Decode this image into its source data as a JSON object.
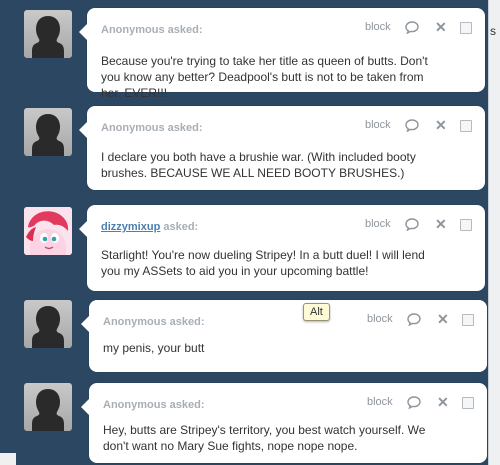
{
  "page": {
    "edge_label": "s"
  },
  "tooltip": {
    "text": "Alt"
  },
  "asks": [
    {
      "avatar_icon": "anonymous-silhouette",
      "asker": "Anonymous",
      "asked_suffix": "asked:",
      "block_label": "block",
      "question": "Because you're trying to take her title as queen of butts. Don't you know any better? Deadpool's butt is not to be taken from her. EVER!!!"
    },
    {
      "avatar_icon": "anonymous-silhouette",
      "asker": "Anonymous",
      "asked_suffix": "asked:",
      "block_label": "block",
      "question": "I declare you both have a brushie war. (With included booty brushes. BECAUSE WE ALL NEED BOOTY BRUSHES.)"
    },
    {
      "avatar_icon": "pink-pony-avatar",
      "asker": "dizzymixup",
      "asked_suffix": "asked:",
      "block_label": "block",
      "question": "Starlight! You're now dueling Stripey! In a butt duel! I will lend you my ASSets to aid you in your upcoming battle!"
    },
    {
      "avatar_icon": "anonymous-silhouette",
      "asker": "Anonymous",
      "asked_suffix": "asked:",
      "block_label": "block",
      "question": "my penis, your butt"
    },
    {
      "avatar_icon": "anonymous-silhouette",
      "asker": "Anonymous",
      "asked_suffix": "asked:",
      "block_label": "block",
      "question": "Hey, butts are Stripey's territory, you best watch yourself. We don't want no Mary Sue fights, nope nope nope."
    }
  ]
}
